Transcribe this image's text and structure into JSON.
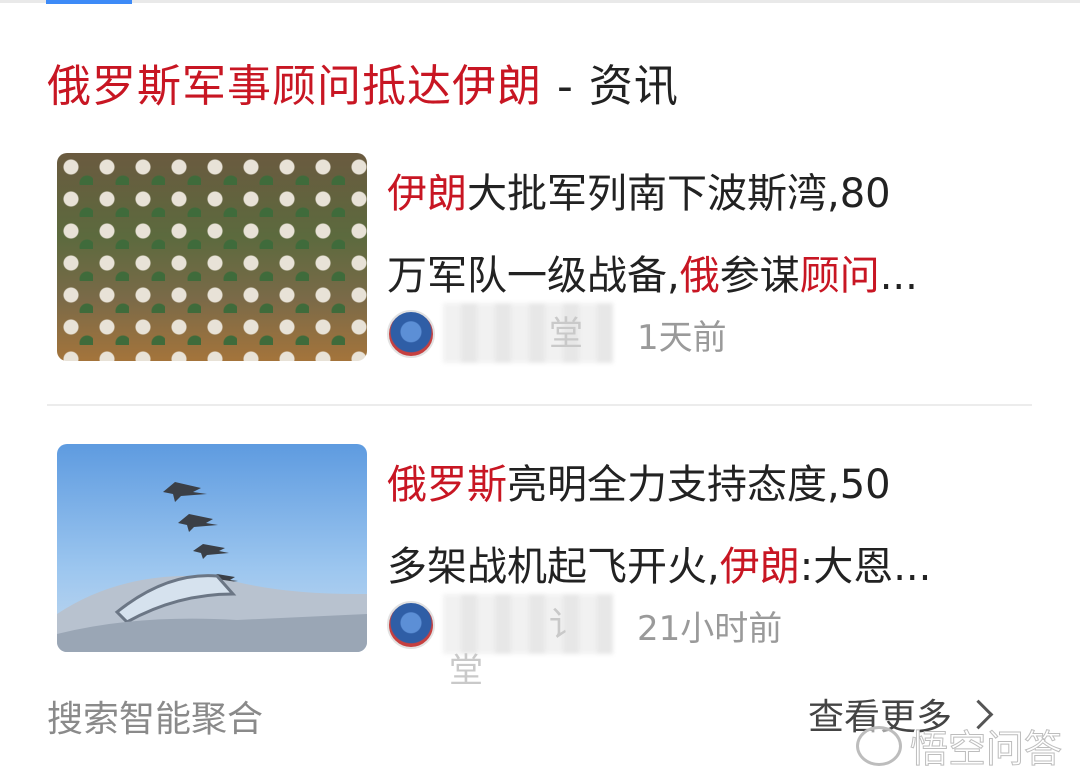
{
  "header": {
    "title_highlight": "俄罗斯军事顾问抵达伊朗",
    "title_suffix": " - 资讯"
  },
  "results": [
    {
      "image_icon": "troops-parade-image",
      "headline_line1": [
        {
          "text": "伊朗",
          "hl": true
        },
        {
          "text": "大批军列南下波斯湾,80",
          "hl": false
        }
      ],
      "headline_line2": [
        {
          "text": "万军队一级战备,",
          "hl": false
        },
        {
          "text": "俄",
          "hl": true
        },
        {
          "text": "参谋",
          "hl": false
        },
        {
          "text": "顾问",
          "hl": true
        },
        {
          "text": "...",
          "hl": false
        }
      ],
      "source_visible": "堂",
      "time": "1天前"
    },
    {
      "image_icon": "fighter-jets-image",
      "headline_line1": [
        {
          "text": "俄罗斯",
          "hl": true
        },
        {
          "text": "亮明全力支持态度,50",
          "hl": false
        }
      ],
      "headline_line2": [
        {
          "text": "多架战机起飞开火,",
          "hl": false
        },
        {
          "text": "伊朗",
          "hl": true
        },
        {
          "text": ":大恩...",
          "hl": false
        }
      ],
      "source_visible": "讠 堂",
      "time": "21小时前"
    }
  ],
  "footer": {
    "aggregation_label": "搜索智能聚合",
    "see_more_label": "查看更多",
    "watermark": "悟空问答"
  },
  "colors": {
    "highlight": "#c81623",
    "accent_tab": "#3d8af7"
  }
}
